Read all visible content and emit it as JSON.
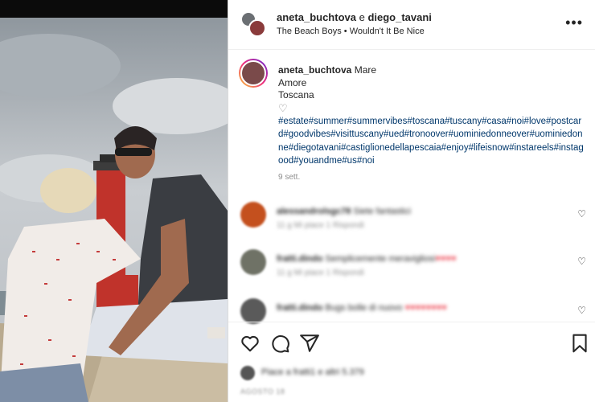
{
  "header": {
    "user1": "aneta_buchtova",
    "conj": " e ",
    "user2": "diego_tavani",
    "audio_artist": "The Beach Boys",
    "audio_sep": " • ",
    "audio_title": "Wouldn't It Be Nice",
    "more_label": "•••"
  },
  "caption": {
    "user": "aneta_buchtova",
    "line1": "Mare",
    "line2": "Amore",
    "line3": "Toscana",
    "heart": "♡",
    "hashtags": "#estate#summer#summervibes#toscana#tuscany#casa#noi#love#postcard#goodvibes#visittuscany#ued#tronoover#uominiedonneover#uominiedonne#diegotavani#castiglionedellapescaia#enjoy#lifeisnow#instareels#instagood#youandme#us#noi",
    "time": "9 sett."
  },
  "comments": [
    {
      "user": "alessandrolsgc78",
      "text": "Siete fantastici",
      "hearts": "",
      "meta": "11 g    Mi piace 1    Rispondi",
      "avatar_color": "#c4501e"
    },
    {
      "user": "fratti.dindo",
      "text": "Semplicemente meravigliosi",
      "hearts": "♥♥♥♥",
      "meta": "11 g    Mi piace 1    Rispondi",
      "avatar_color": "#6f7266"
    },
    {
      "user": "fratti.dindo",
      "text": "Bugs bolle di nuovo",
      "hearts": "♥♥♥♥♥♥♥♥",
      "meta": "",
      "avatar_color": "#5a5a5a"
    }
  ],
  "like_icon": "♡",
  "actions": [
    "heart-icon",
    "comment-icon",
    "share-icon",
    "bookmark-icon"
  ],
  "likes_text": "Piace a fratti1 e altri 5.379",
  "date_text": "AGOSTO 18"
}
